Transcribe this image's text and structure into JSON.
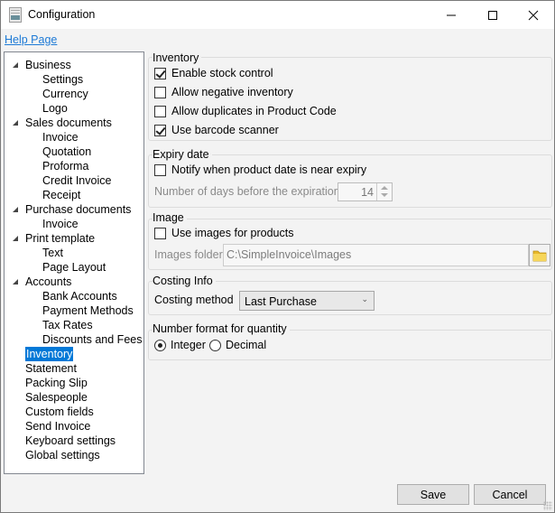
{
  "window": {
    "title": "Configuration",
    "controls": {
      "minimize": "minimize",
      "maximize": "maximize",
      "close": "close"
    }
  },
  "help_link": "Help Page",
  "tree": {
    "items": [
      {
        "label": "Business",
        "level": 0,
        "expanded": true
      },
      {
        "label": "Settings",
        "level": 1
      },
      {
        "label": "Currency",
        "level": 1
      },
      {
        "label": "Logo",
        "level": 1
      },
      {
        "label": "Sales documents",
        "level": 0,
        "expanded": true
      },
      {
        "label": "Invoice",
        "level": 1
      },
      {
        "label": "Quotation",
        "level": 1
      },
      {
        "label": "Proforma",
        "level": 1
      },
      {
        "label": "Credit Invoice",
        "level": 1
      },
      {
        "label": "Receipt",
        "level": 1
      },
      {
        "label": "Purchase documents",
        "level": 0,
        "expanded": true
      },
      {
        "label": "Invoice",
        "level": 1
      },
      {
        "label": "Print template",
        "level": 0,
        "expanded": true
      },
      {
        "label": "Text",
        "level": 1
      },
      {
        "label": "Page Layout",
        "level": 1
      },
      {
        "label": "Accounts",
        "level": 0,
        "expanded": true
      },
      {
        "label": "Bank Accounts",
        "level": 1
      },
      {
        "label": "Payment Methods",
        "level": 1
      },
      {
        "label": "Tax Rates",
        "level": 1
      },
      {
        "label": "Discounts and Fees",
        "level": 1
      },
      {
        "label": "Inventory",
        "level": 0,
        "selected": true
      },
      {
        "label": "Statement",
        "level": 0
      },
      {
        "label": "Packing Slip",
        "level": 0
      },
      {
        "label": "Salespeople",
        "level": 0
      },
      {
        "label": "Custom fields",
        "level": 0
      },
      {
        "label": "Send Invoice",
        "level": 0
      },
      {
        "label": "Keyboard settings",
        "level": 0
      },
      {
        "label": "Global settings",
        "level": 0
      }
    ]
  },
  "inventory": {
    "title": "Inventory",
    "enable_stock_control": {
      "label": "Enable stock control",
      "checked": true
    },
    "allow_negative": {
      "label": "Allow negative inventory",
      "checked": false
    },
    "allow_duplicates": {
      "label": "Allow duplicates in Product Code",
      "checked": false
    },
    "use_barcode": {
      "label": "Use barcode scanner",
      "checked": true
    }
  },
  "expiry": {
    "title": "Expiry date",
    "notify": {
      "label": "Notify when product date is near expiry",
      "checked": false
    },
    "days_label": "Number of days before the expiration",
    "days_value": "14"
  },
  "image": {
    "title": "Image",
    "use_images": {
      "label": "Use images for products",
      "checked": false
    },
    "folder_label": "Images folder",
    "folder_value": "C:\\SimpleInvoice\\Images"
  },
  "costing": {
    "title": "Costing Info",
    "method_label": "Costing method",
    "method_value": "Last Purchase"
  },
  "number_format": {
    "title": "Number format for quantity",
    "options": [
      {
        "label": "Integer",
        "selected": true
      },
      {
        "label": "Decimal",
        "selected": false
      }
    ]
  },
  "buttons": {
    "save": "Save",
    "cancel": "Cancel"
  }
}
